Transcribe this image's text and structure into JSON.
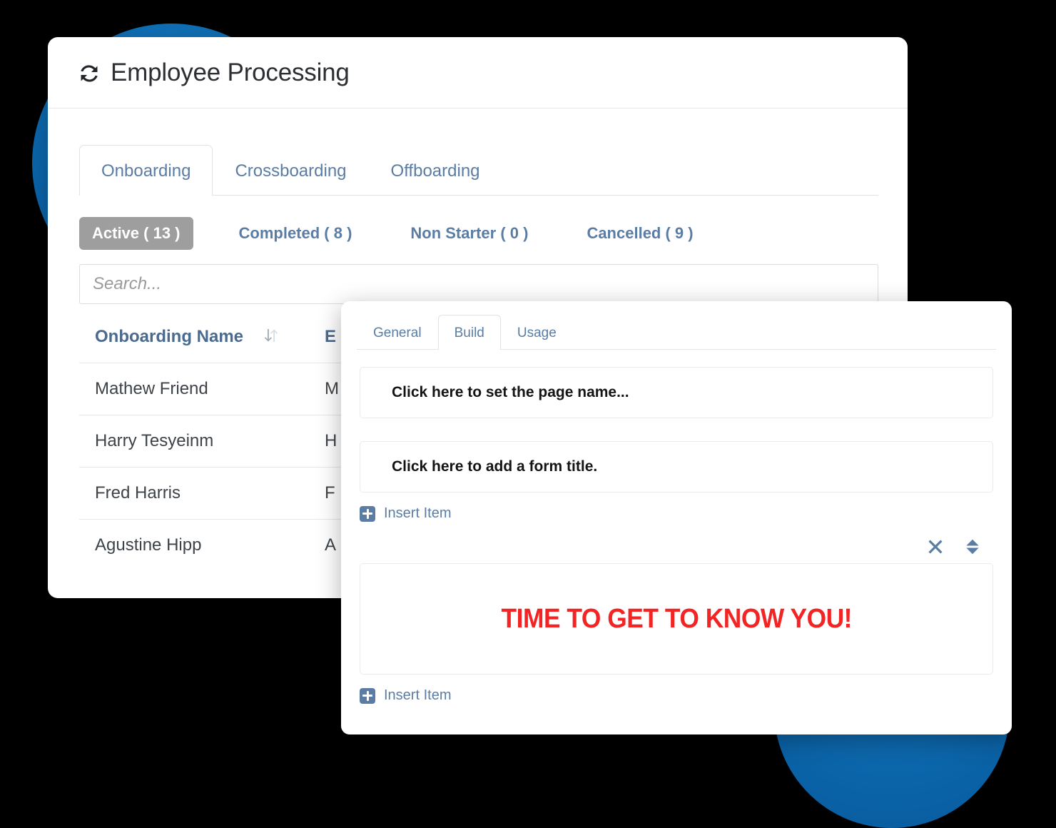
{
  "background": {
    "accent_color": "#0d6cb1",
    "page_color": "#000000"
  },
  "main_card": {
    "header": {
      "icon": "refresh-icon",
      "title": "Employee Processing"
    },
    "tabs": [
      {
        "label": "Onboarding",
        "active": true
      },
      {
        "label": "Crossboarding",
        "active": false
      },
      {
        "label": "Offboarding",
        "active": false
      }
    ],
    "status_filters": [
      {
        "label": "Active ( 13 )",
        "active": true
      },
      {
        "label": "Completed ( 8 )",
        "active": false
      },
      {
        "label": "Non Starter ( 0 )",
        "active": false
      },
      {
        "label": "Cancelled ( 9 )",
        "active": false
      }
    ],
    "search": {
      "value": "",
      "placeholder": "Search..."
    },
    "table": {
      "columns": [
        {
          "label": "Onboarding Name",
          "sortable": true,
          "sort_icon": "sort-updown-icon"
        },
        {
          "label": "E",
          "sortable": false
        }
      ],
      "rows": [
        {
          "name": "Mathew Friend",
          "email": "M"
        },
        {
          "name": "Harry Tesyeinm",
          "email": "H"
        },
        {
          "name": "Fred Harris",
          "email": "F"
        },
        {
          "name": "Agustine Hipp",
          "email": "A"
        }
      ]
    }
  },
  "overlay_panel": {
    "tabs": [
      {
        "label": "General",
        "active": false
      },
      {
        "label": "Build",
        "active": true
      },
      {
        "label": "Usage",
        "active": false
      }
    ],
    "page_name_field": "Click here to set the page name...",
    "form_title_field": "Click here to add a form title.",
    "insert_item_top": "Insert Item",
    "item_toolbar": [
      {
        "icon": "close-icon",
        "name": "remove-item-button"
      },
      {
        "icon": "move-updown-icon",
        "name": "reorder-item-button"
      }
    ],
    "banner_text": "TIME TO GET TO KNOW YOU!",
    "banner_color": "#f22424",
    "insert_item_bottom": "Insert Item"
  }
}
